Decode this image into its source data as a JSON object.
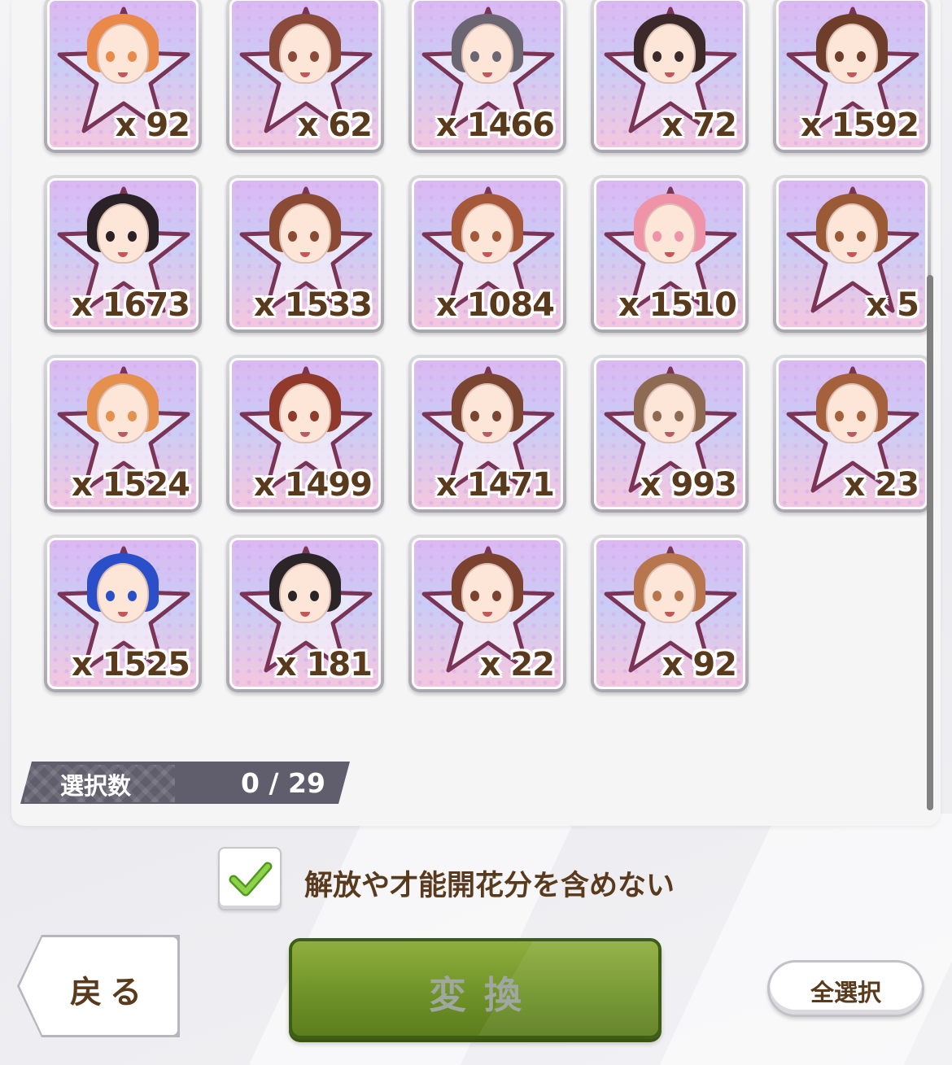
{
  "cards": [
    {
      "count": "x 92",
      "hair": "#e9894a"
    },
    {
      "count": "x 62",
      "hair": "#8a4b3a"
    },
    {
      "count": "x 1466",
      "hair": "#6b6672"
    },
    {
      "count": "x 72",
      "hair": "#3c2a2a"
    },
    {
      "count": "x 1592",
      "hair": "#6f3e2a"
    },
    {
      "count": "x 1673",
      "hair": "#2a2226"
    },
    {
      "count": "x 1533",
      "hair": "#8a4a34"
    },
    {
      "count": "x 1084",
      "hair": "#a5583a"
    },
    {
      "count": "x 1510",
      "hair": "#ef93a8"
    },
    {
      "count": "x 5",
      "hair": "#9a5a36"
    },
    {
      "count": "x 1524",
      "hair": "#e5904c"
    },
    {
      "count": "x 1499",
      "hair": "#8f3a2a"
    },
    {
      "count": "x 1471",
      "hair": "#7a4632"
    },
    {
      "count": "x 993",
      "hair": "#8e6a52"
    },
    {
      "count": "x 23",
      "hair": "#a5603c"
    },
    {
      "count": "x 1525",
      "hair": "#2a4fc9"
    },
    {
      "count": "x 181",
      "hair": "#2b2528"
    },
    {
      "count": "x 22",
      "hair": "#7c4230"
    },
    {
      "count": "x 92",
      "hair": "#b8764e"
    }
  ],
  "selection": {
    "label": "選択数",
    "value": "0 / 29"
  },
  "option": {
    "checked": true,
    "label": "解放や才能開花分を含めない"
  },
  "buttons": {
    "back": "戻る",
    "convert": "変換",
    "select_all": "全選択"
  },
  "colors": {
    "text_brown": "#5a3a1c",
    "convert_green": "#6f9328",
    "check_green": "#7cc33a"
  }
}
